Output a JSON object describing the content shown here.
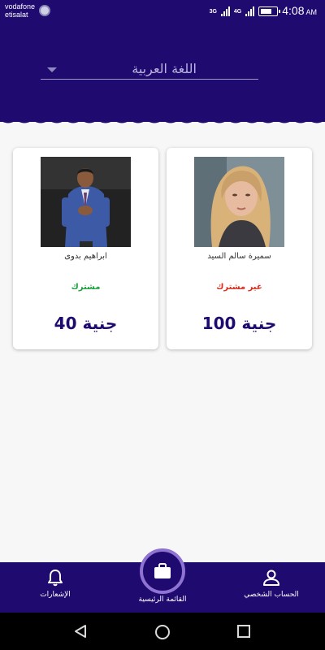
{
  "status_bar": {
    "carrier_1": "vodafone",
    "carrier_2": "etisalat",
    "net_1": "3G",
    "net_2": "4G",
    "time": "4:08",
    "am_pm": "AM",
    "battery_level": 0.75
  },
  "header": {
    "language_select": "اللغة العربية"
  },
  "cards": [
    {
      "name": "سميرة سالم السيد",
      "status": "غير مشترك",
      "price": "جنية 100"
    },
    {
      "name": "ابراهيم بدوى",
      "status": "مشترك",
      "price": "جنية 40"
    }
  ],
  "bottom_nav": {
    "profile": "الحساب الشخصي",
    "home": "القائمة الرئيسية",
    "notifications": "الإشعارات"
  },
  "colors": {
    "primary": "#1f0a70",
    "subscribed": "#18a33a",
    "unsubscribed": "#e02a1a",
    "home_ring": "#8f73d2"
  },
  "icons": {
    "profile": "person-icon",
    "home": "briefcase-icon",
    "notifications": "bell-icon",
    "android_back": "back-icon",
    "android_home": "circle-home-icon",
    "android_recents": "square-recents-icon"
  }
}
